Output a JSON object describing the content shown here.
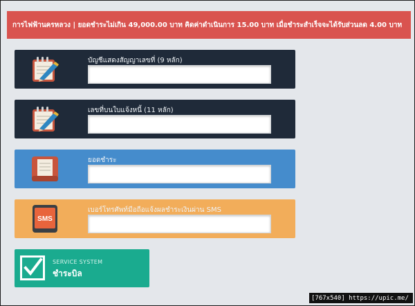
{
  "banner": {
    "text": "การไฟฟ้านครหลวง | ยอดชำระไม่เกิน 49,000.00 บาท คิดค่าดำเนินการ 15.00 บาท เมื่อชำระสำเร็จจะได้รับส่วนลด 4.00 บาท"
  },
  "fields": [
    {
      "label": "บัญชีแสดงสัญญาเลขที่ (9 หลัก)",
      "value": "",
      "icon": "notepad-pencil-icon"
    },
    {
      "label": "เลขที่บนใบแจ้งหนี้ (11 หลัก)",
      "value": "",
      "icon": "notepad-pencil-icon"
    },
    {
      "label": "ยอดชำระ",
      "value": "",
      "icon": "clipboard-icon"
    },
    {
      "label": "เบอร์โทรศัพท์มือถือแจ้งผลชำระเงินผ่าน SMS",
      "value": "",
      "icon": "sms-phone-icon"
    }
  ],
  "sms_icon_text": "SMS",
  "service": {
    "subtitle": "SERVICE SYSTEM",
    "title": "ชำระบิล",
    "icon": "checkbox-icon"
  },
  "watermark": "[767x540] https://upic.me/",
  "colors": {
    "banner": "#d9534f",
    "panel_dark": "#1f2a39",
    "panel_blue": "#458ccc",
    "panel_orange": "#f2ad5a",
    "service": "#1aab8f",
    "background": "#e4e7eb"
  }
}
